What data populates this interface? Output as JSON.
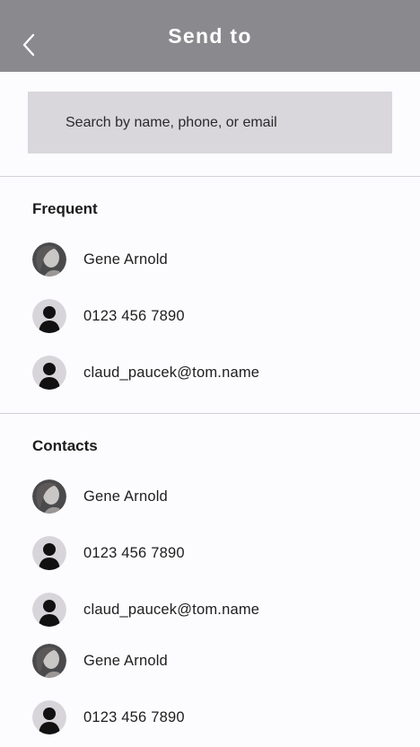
{
  "header": {
    "title": "Send to",
    "back_icon": "chevron-left-icon"
  },
  "search": {
    "placeholder": "Search by name, phone, or email",
    "value": ""
  },
  "sections": {
    "frequent": {
      "title": "Frequent",
      "items": [
        {
          "label": "Gene Arnold",
          "avatar": "photo"
        },
        {
          "label": "0123 456 7890",
          "avatar": "placeholder-person-icon"
        },
        {
          "label": "claud_paucek@tom.name",
          "avatar": "placeholder-person-icon"
        }
      ]
    },
    "contacts": {
      "title": "Contacts",
      "items": [
        {
          "label": "Gene Arnold",
          "avatar": "photo"
        },
        {
          "label": "0123 456 7890",
          "avatar": "placeholder-person-icon"
        },
        {
          "label": "claud_paucek@tom.name",
          "avatar": "placeholder-person-icon"
        },
        {
          "label": "Gene Arnold",
          "avatar": "photo"
        },
        {
          "label": "0123 456 7890",
          "avatar": "placeholder-person-icon"
        }
      ]
    }
  },
  "colors": {
    "header_bg": "#8a898e",
    "search_bg": "#d9d7dc",
    "background": "#fcfbfd"
  }
}
